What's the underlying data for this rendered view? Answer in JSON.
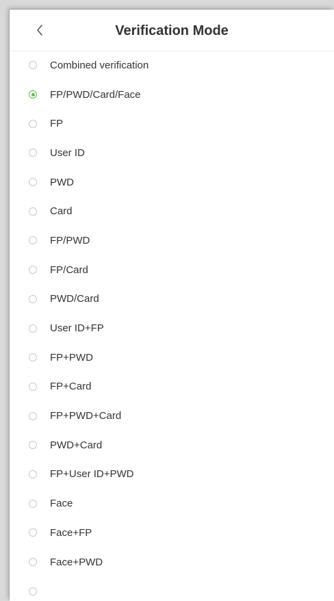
{
  "header": {
    "title": "Verification Mode"
  },
  "colors": {
    "accent": "#5cbc4b",
    "text": "#333333",
    "radio_border": "#c8c8c8"
  },
  "options": [
    {
      "label": "Combined verification",
      "selected": false
    },
    {
      "label": "FP/PWD/Card/Face",
      "selected": true
    },
    {
      "label": "FP",
      "selected": false
    },
    {
      "label": "User ID",
      "selected": false
    },
    {
      "label": "PWD",
      "selected": false
    },
    {
      "label": "Card",
      "selected": false
    },
    {
      "label": "FP/PWD",
      "selected": false
    },
    {
      "label": "FP/Card",
      "selected": false
    },
    {
      "label": "PWD/Card",
      "selected": false
    },
    {
      "label": "User ID+FP",
      "selected": false
    },
    {
      "label": "FP+PWD",
      "selected": false
    },
    {
      "label": "FP+Card",
      "selected": false
    },
    {
      "label": "FP+PWD+Card",
      "selected": false
    },
    {
      "label": "PWD+Card",
      "selected": false
    },
    {
      "label": "FP+User ID+PWD",
      "selected": false
    },
    {
      "label": "Face",
      "selected": false
    },
    {
      "label": "Face+FP",
      "selected": false
    },
    {
      "label": "Face+PWD",
      "selected": false
    },
    {
      "label": "",
      "selected": false
    }
  ]
}
